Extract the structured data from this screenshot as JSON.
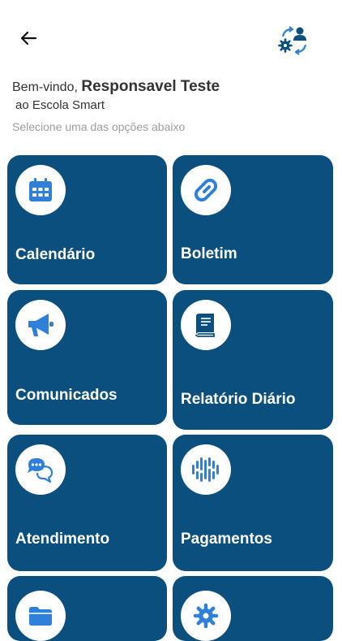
{
  "header": {
    "back_icon": "arrow-left-icon",
    "switch_icon": "switch-user-icon"
  },
  "welcome": {
    "greeting": "Bem-vindo, ",
    "user_name": "Responsavel Teste",
    "school": "ao Escola Smart",
    "hint": "Selecione uma das opções abaixo"
  },
  "menu": {
    "calendario": "Calendário",
    "boletim": "Boletim",
    "comunicados": "Comunicados",
    "relatorio": "Relatório Diário",
    "atendimento": "Atendimento",
    "pagamentos": "Pagamentos"
  },
  "colors": {
    "card_background": "#0a4f7d",
    "icon_blue": "#2f80d8",
    "text_dark": "#333333",
    "text_muted": "#9e9e9e"
  }
}
